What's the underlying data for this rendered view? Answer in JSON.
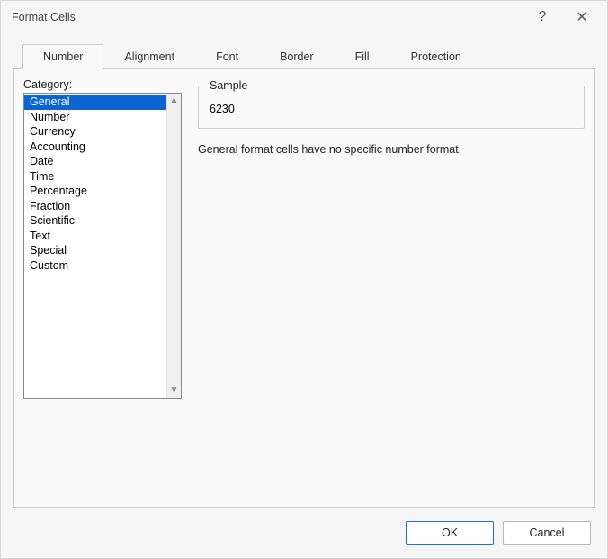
{
  "window": {
    "title": "Format Cells",
    "help_tooltip": "?",
    "close_tooltip": "✕"
  },
  "tabs": [
    {
      "label": "Number",
      "active": true
    },
    {
      "label": "Alignment",
      "active": false
    },
    {
      "label": "Font",
      "active": false
    },
    {
      "label": "Border",
      "active": false
    },
    {
      "label": "Fill",
      "active": false
    },
    {
      "label": "Protection",
      "active": false
    }
  ],
  "category": {
    "label": "Category:",
    "items": [
      "General",
      "Number",
      "Currency",
      "Accounting",
      "Date",
      "Time",
      "Percentage",
      "Fraction",
      "Scientific",
      "Text",
      "Special",
      "Custom"
    ],
    "selected_index": 0
  },
  "sample": {
    "legend": "Sample",
    "value": "6230"
  },
  "description": "General format cells have no specific number format.",
  "buttons": {
    "ok": "OK",
    "cancel": "Cancel"
  }
}
